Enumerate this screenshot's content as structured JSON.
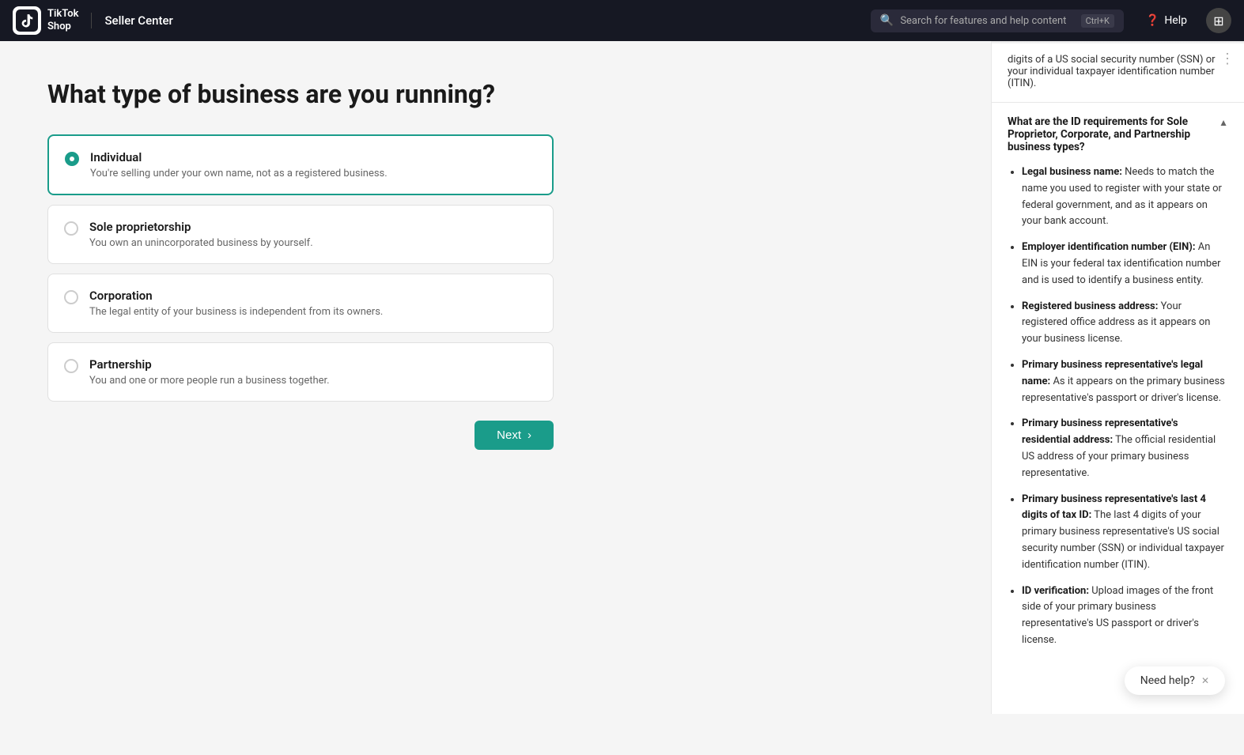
{
  "header": {
    "logo_text": "TikTok\nShop",
    "app_name": "Seller Center",
    "search_placeholder": "Search for features and help content",
    "search_shortcut": "Ctrl+K",
    "help_label": "Help"
  },
  "page": {
    "title": "What type of business are you running?",
    "options": [
      {
        "id": "individual",
        "name": "Individual",
        "description": "You're selling under your own name, not as a registered business.",
        "selected": true
      },
      {
        "id": "sole-proprietorship",
        "name": "Sole proprietorship",
        "description": "You own an unincorporated business by yourself.",
        "selected": false
      },
      {
        "id": "corporation",
        "name": "Corporation",
        "description": "The legal entity of your business is independent from its owners.",
        "selected": false
      },
      {
        "id": "partnership",
        "name": "Partnership",
        "description": "You and one or more people run a business together.",
        "selected": false
      }
    ],
    "next_button": "Next"
  },
  "help_sidebar": {
    "top_text": "digits of a US social security number (SSN) or your individual taxpayer identification number (ITIN).",
    "section_title": "What are the ID requirements for Sole Proprietor, Corporate, and Partnership business types?",
    "items": [
      {
        "label": "Legal business name:",
        "text": "Needs to match the name you used to register with your state or federal government, and as it appears on your bank account."
      },
      {
        "label": "Employer identification number (EIN):",
        "text": "An EIN is your federal tax identification number and is used to identify a business entity."
      },
      {
        "label": "Registered business address:",
        "text": "Your registered office address as it appears on your business license."
      },
      {
        "label": "Primary business representative's legal name:",
        "text": "As it appears on the primary business representative's passport or driver's license."
      },
      {
        "label": "Primary business representative's residential address:",
        "text": "The official residential US address of your primary business representative."
      },
      {
        "label": "Primary business representative's last 4 digits of tax ID:",
        "text": "The last 4 digits of your primary business representative's US social security number (SSN) or individual taxpayer identification number (ITIN)."
      },
      {
        "label": "ID verification:",
        "text": "Upload images of the front side of your primary business representative's US passport or driver's license."
      }
    ]
  },
  "need_help": {
    "label": "Need help?"
  }
}
